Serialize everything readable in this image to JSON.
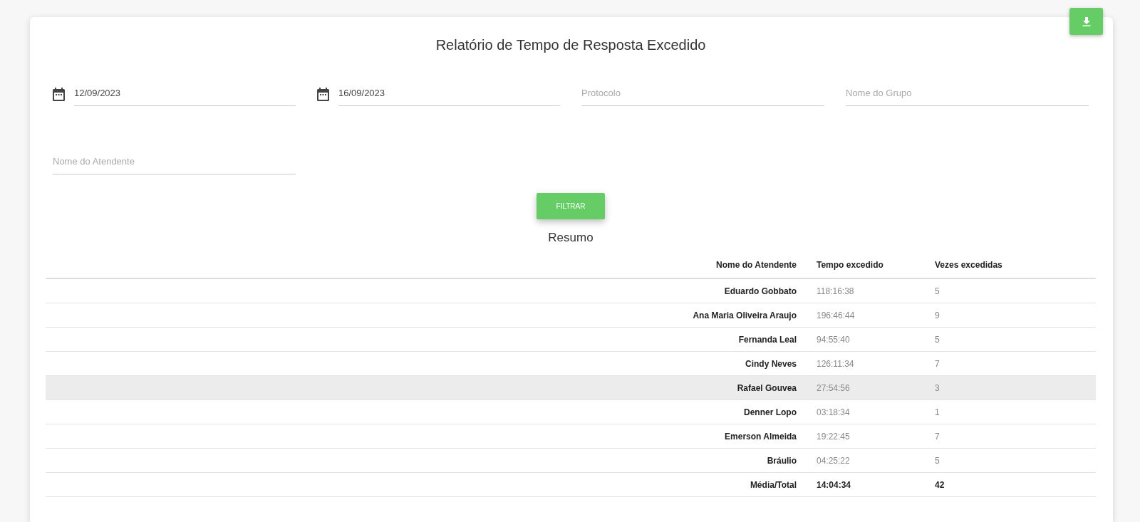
{
  "title": "Relatório de Tempo de Resposta Excedido",
  "filters": [
    {
      "kind": "date",
      "value": "12/09/2023"
    },
    {
      "kind": "date",
      "value": "16/09/2023"
    },
    {
      "kind": "text",
      "placeholder": "Protocolo"
    },
    {
      "kind": "text",
      "placeholder": "Nome do Grupo"
    },
    {
      "kind": "text",
      "placeholder": "Nome do Atendente"
    }
  ],
  "filter_button": "FILTRAR",
  "summary": {
    "title": "Resumo",
    "columns": [
      "Nome do Atendente",
      "Tempo excedido",
      "Vezes excedidas"
    ],
    "rows": [
      {
        "name": "Eduardo Gobbato",
        "time": "118:16:38",
        "count": "5",
        "highlighted": false
      },
      {
        "name": "Ana Maria Oliveira Araujo",
        "time": "196:46:44",
        "count": "9",
        "highlighted": false
      },
      {
        "name": "Fernanda Leal",
        "time": "94:55:40",
        "count": "5",
        "highlighted": false
      },
      {
        "name": "Cindy Neves",
        "time": "126:11:34",
        "count": "7",
        "highlighted": false
      },
      {
        "name": "Rafael Gouvea",
        "time": "27:54:56",
        "count": "3",
        "highlighted": true
      },
      {
        "name": "Denner Lopo",
        "time": "03:18:34",
        "count": "1",
        "highlighted": false
      },
      {
        "name": "Emerson Almeida",
        "time": "19:22:45",
        "count": "7",
        "highlighted": false
      },
      {
        "name": "Bráulio",
        "time": "04:25:22",
        "count": "5",
        "highlighted": false
      }
    ],
    "total": {
      "name": "Média/Total",
      "time": "14:04:34",
      "count": "42"
    }
  }
}
